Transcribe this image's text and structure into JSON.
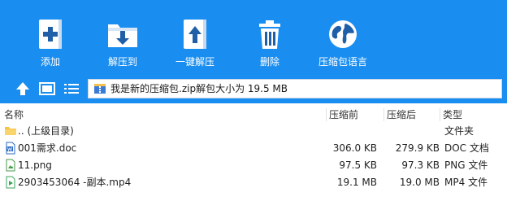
{
  "toolbar": {
    "buttons": [
      {
        "label": "添加",
        "icon": "add-icon"
      },
      {
        "label": "解压到",
        "icon": "extract-to-icon"
      },
      {
        "label": "一键解压",
        "icon": "one-click-extract-icon"
      },
      {
        "label": "删除",
        "icon": "trash-icon"
      },
      {
        "label": "压缩包语言",
        "icon": "globe-icon"
      }
    ]
  },
  "address": {
    "path": "我是新的压缩包.zip解包大小为 19.5 MB",
    "icon": "zip-archive-icon"
  },
  "columns": {
    "name": "名称",
    "packed": "压缩前",
    "unpacked": "压缩后",
    "type": "类型"
  },
  "files": [
    {
      "name": ".. (上级目录)",
      "packed": "",
      "unpacked": "",
      "type": "文件夹",
      "icon": "folder-icon"
    },
    {
      "name": "001需求.doc",
      "packed": "306.0 KB",
      "unpacked": "279.9 KB",
      "type": "DOC 文档",
      "icon": "doc-icon"
    },
    {
      "name": "11.png",
      "packed": "97.5 KB",
      "unpacked": "97.3 KB",
      "type": "PNG 文件",
      "icon": "image-file-icon"
    },
    {
      "name": "2903453064 -副本.mp4",
      "packed": "19.1 MB",
      "unpacked": "19.0 MB",
      "type": "MP4 文件",
      "icon": "video-file-icon"
    }
  ],
  "colors": {
    "toolbar_bg": "#1a8ef0",
    "icon_panel": "#ffffff",
    "accent_dark": "#1f5fa8",
    "folder": "#f5c242"
  }
}
